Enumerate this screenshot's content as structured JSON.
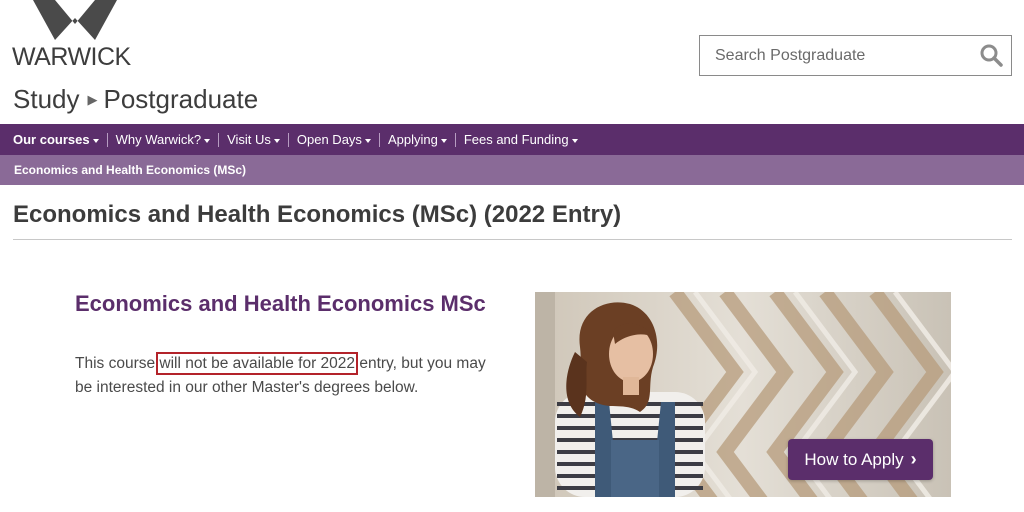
{
  "brand": {
    "logo_text": "WARWICK",
    "color": "#5b2e6b"
  },
  "breadcrumb": {
    "items": [
      "Study",
      "Postgraduate"
    ]
  },
  "search": {
    "placeholder": "Search Postgraduate",
    "icon": "search-icon"
  },
  "nav": {
    "items": [
      {
        "label": "Our courses",
        "active": true
      },
      {
        "label": "Why Warwick?"
      },
      {
        "label": "Visit Us"
      },
      {
        "label": "Open Days"
      },
      {
        "label": "Applying"
      },
      {
        "label": "Fees and Funding"
      }
    ]
  },
  "subnav": {
    "current": "Economics and Health Economics (MSc)"
  },
  "page": {
    "title": "Economics and Health Economics (MSc) (2022 Entry)"
  },
  "course": {
    "title": "Economics and Health Economics MSc",
    "text_before": "This course ",
    "text_highlight": "will not be available for 2022",
    "text_after": " entry, but you may be interested in our other Master's degrees below."
  },
  "cta": {
    "label": "How to Apply",
    "icon": "chevron-right-icon"
  }
}
